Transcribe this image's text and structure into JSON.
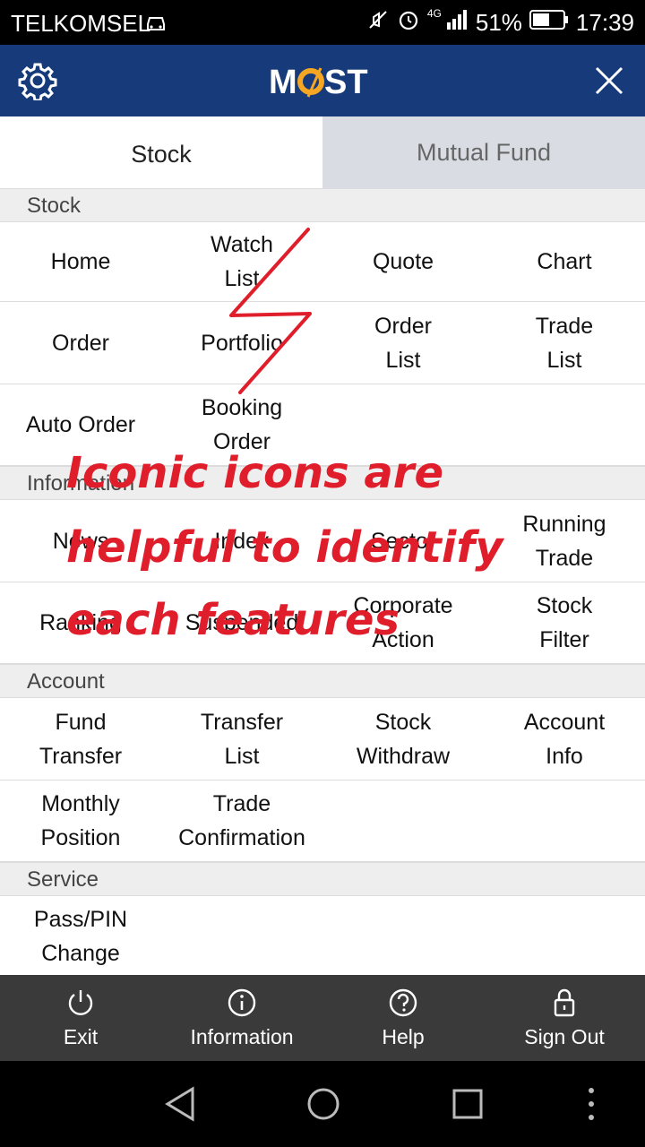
{
  "status_bar": {
    "carrier": "TELKOMSEL",
    "network": "4G",
    "battery": "51%",
    "time": "17:39"
  },
  "header": {
    "logo_text": "MOST"
  },
  "tabs": [
    {
      "label": "Stock",
      "active": true
    },
    {
      "label": "Mutual Fund",
      "active": false
    }
  ],
  "sections": {
    "stock": {
      "title": "Stock",
      "items": [
        "Home",
        "Watch\nList",
        "Quote",
        "Chart",
        "Order",
        "Portfolio",
        "Order\nList",
        "Trade\nList",
        "Auto Order",
        "Booking\nOrder"
      ]
    },
    "information": {
      "title": "Information",
      "items": [
        "News",
        "Index",
        "Sector",
        "Running\nTrade",
        "Ranking",
        "Suspended",
        "Corporate\nAction",
        "Stock\nFilter"
      ]
    },
    "account": {
      "title": "Account",
      "items": [
        "Fund\nTransfer",
        "Transfer\nList",
        "Stock\nWithdraw",
        "Account\nInfo",
        "Monthly\nPosition",
        "Trade\nConfirmation"
      ]
    },
    "service": {
      "title": "Service",
      "items": [
        "Pass/PIN\nChange"
      ]
    }
  },
  "annotation": {
    "lines": [
      "Iconic icons are",
      "helpful to identify",
      "each features"
    ],
    "color": "#e01e2b"
  },
  "bottom_bar": [
    {
      "label": "Exit",
      "icon": "power-icon"
    },
    {
      "label": "Information",
      "icon": "info-icon"
    },
    {
      "label": "Help",
      "icon": "help-icon"
    },
    {
      "label": "Sign Out",
      "icon": "lock-icon"
    }
  ],
  "colors": {
    "header": "#163a7a",
    "logo_accent": "#f5a623",
    "inactive_tab": "#d9dde3"
  }
}
